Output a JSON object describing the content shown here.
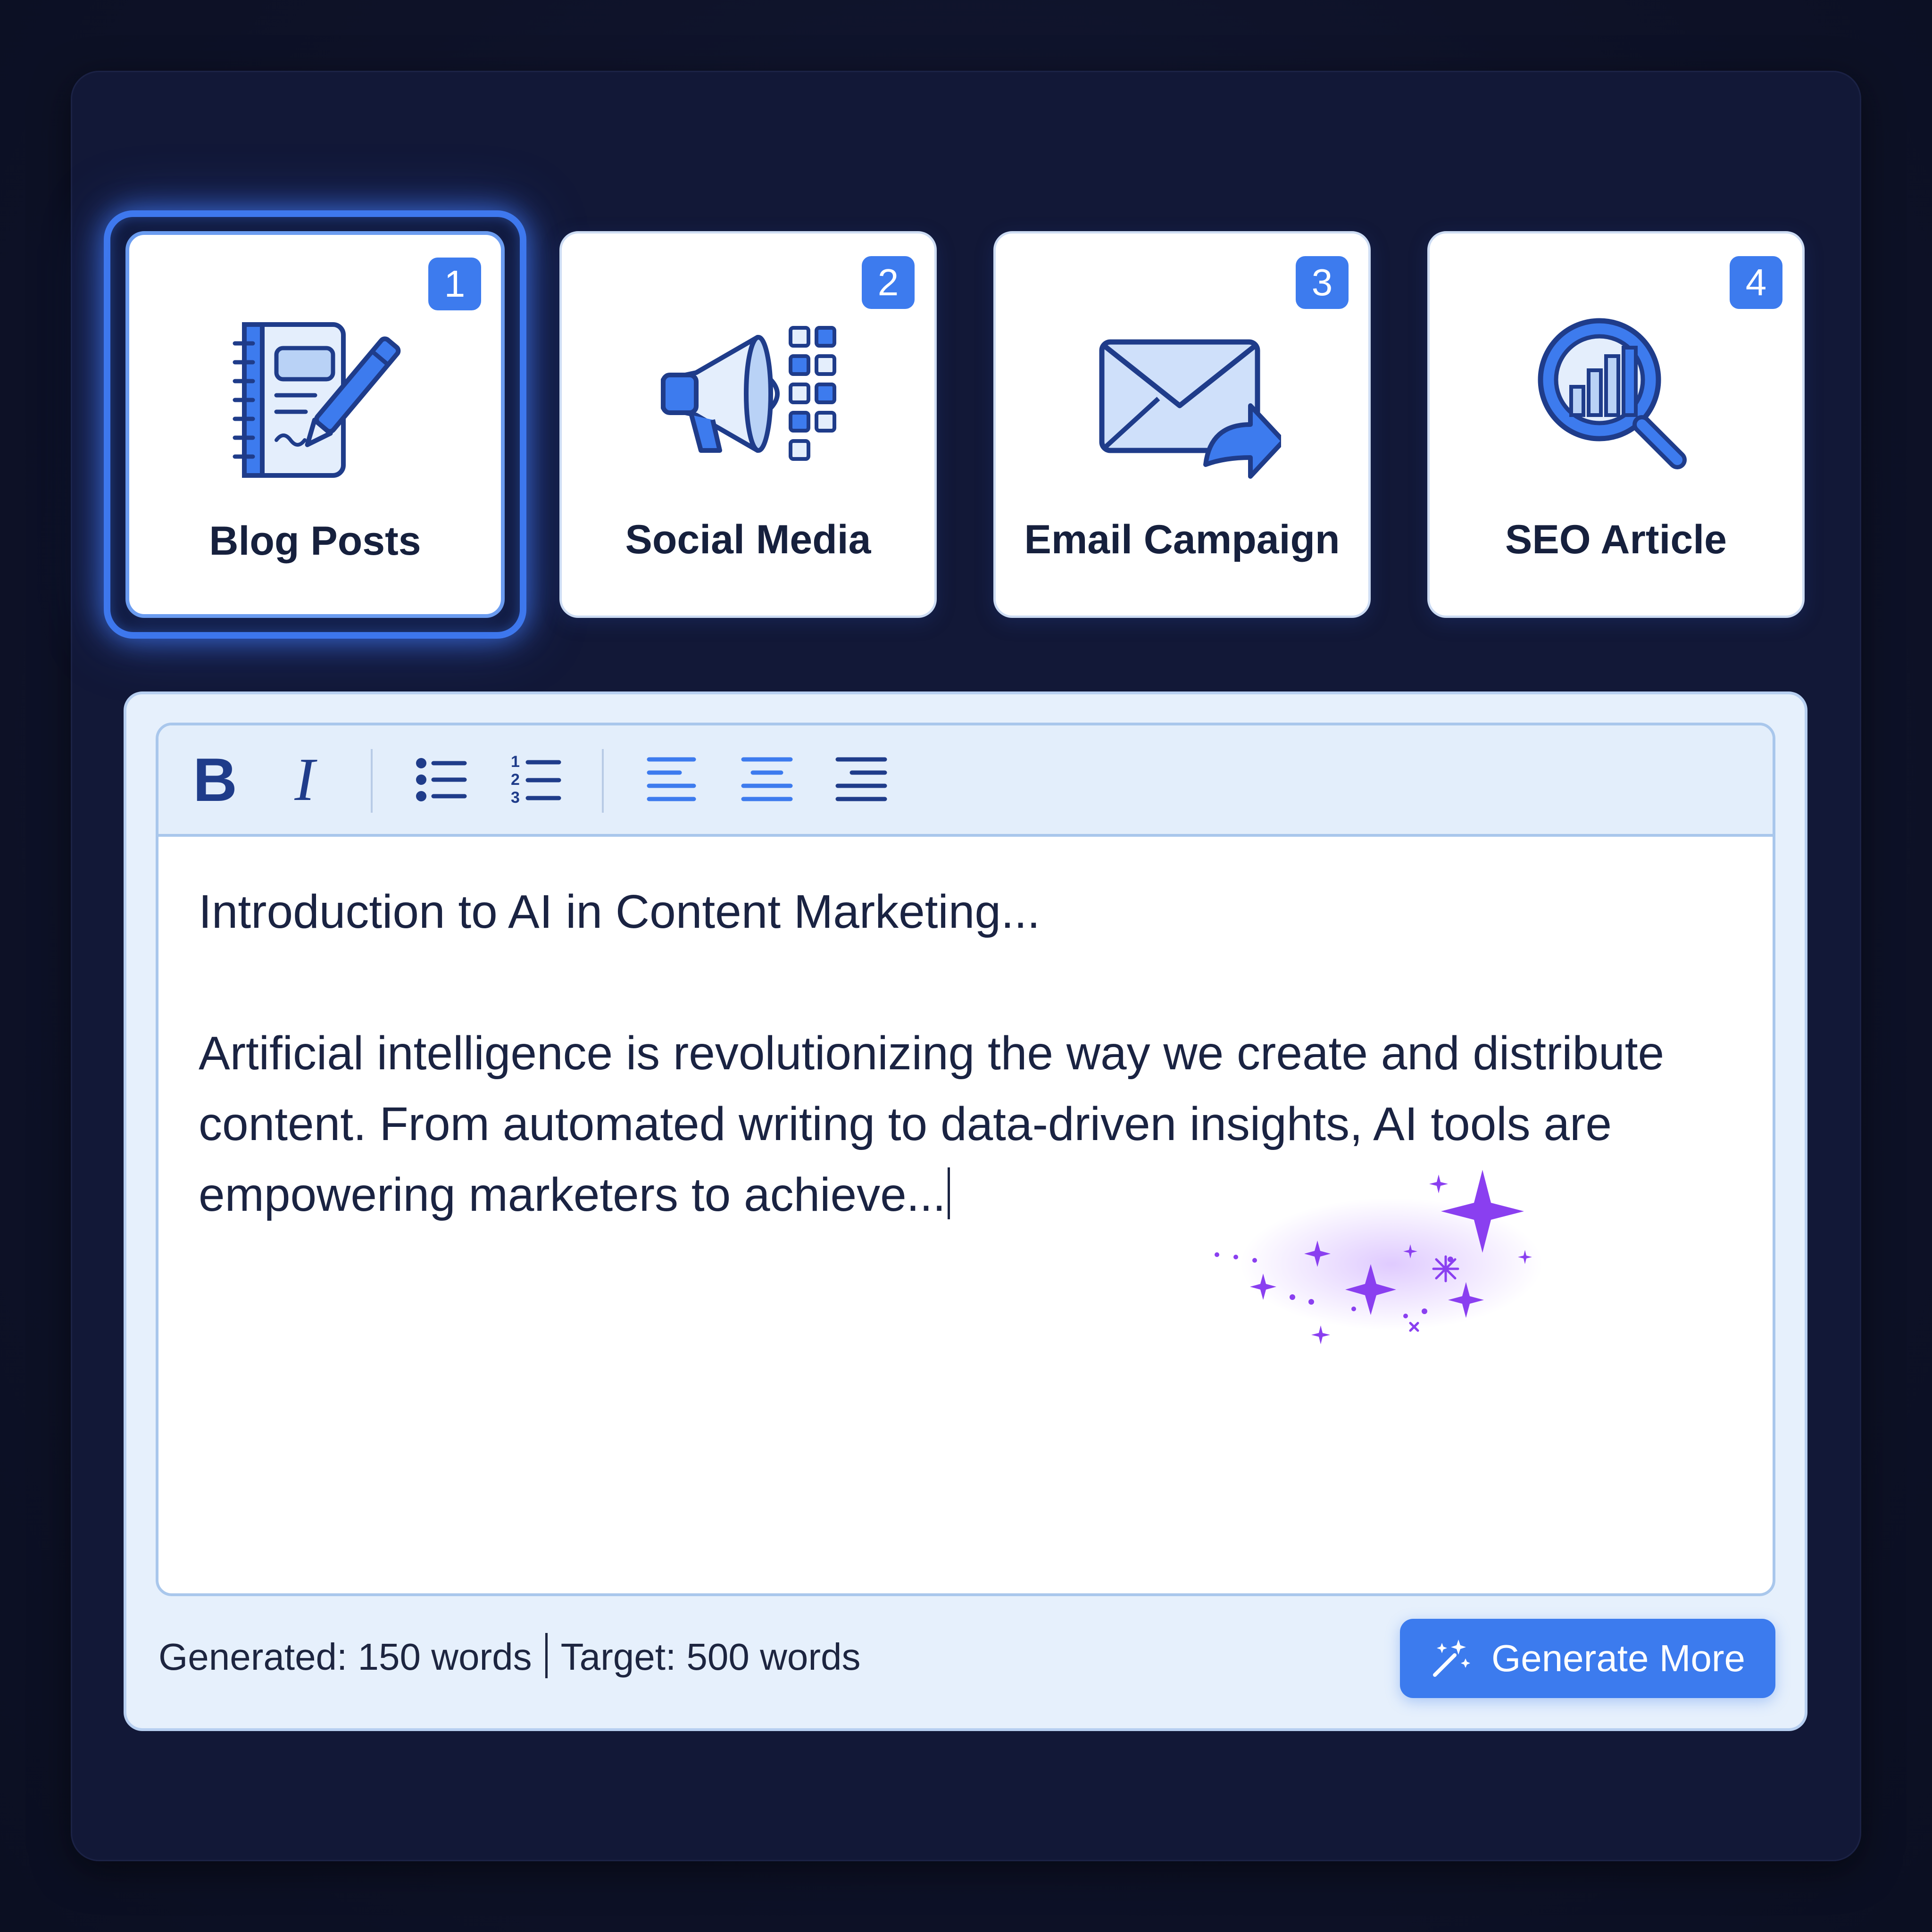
{
  "templates": [
    {
      "number": "1",
      "label": "Blog Posts",
      "icon": "notebook-pen-icon",
      "selected": true
    },
    {
      "number": "2",
      "label": "Social Media",
      "icon": "megaphone-icon",
      "selected": false
    },
    {
      "number": "3",
      "label": "Email Campaign",
      "icon": "envelope-forward-icon",
      "selected": false
    },
    {
      "number": "4",
      "label": "SEO Article",
      "icon": "magnifier-chart-icon",
      "selected": false
    }
  ],
  "toolbar": {
    "bold_label": "B",
    "italic_label": "I",
    "buttons": [
      "bold-icon",
      "italic-icon",
      "bullet-list-icon",
      "numbered-list-icon",
      "align-left-icon",
      "align-center-icon",
      "align-right-icon"
    ]
  },
  "editor": {
    "title": "Introduction to AI in Content Marketing...",
    "body": "Artificial intelligence is revolutionizing the way we create and distribute content. From automated writing to data-driven insights, AI tools are empowering marketers to achieve..."
  },
  "footer": {
    "generated": "Generated: 150 words",
    "target": "Target: 500 words",
    "generate_button": "Generate More"
  },
  "colors": {
    "accent": "#3c7bee",
    "sparkle": "#8a3ff0",
    "background": "#0d1124"
  }
}
